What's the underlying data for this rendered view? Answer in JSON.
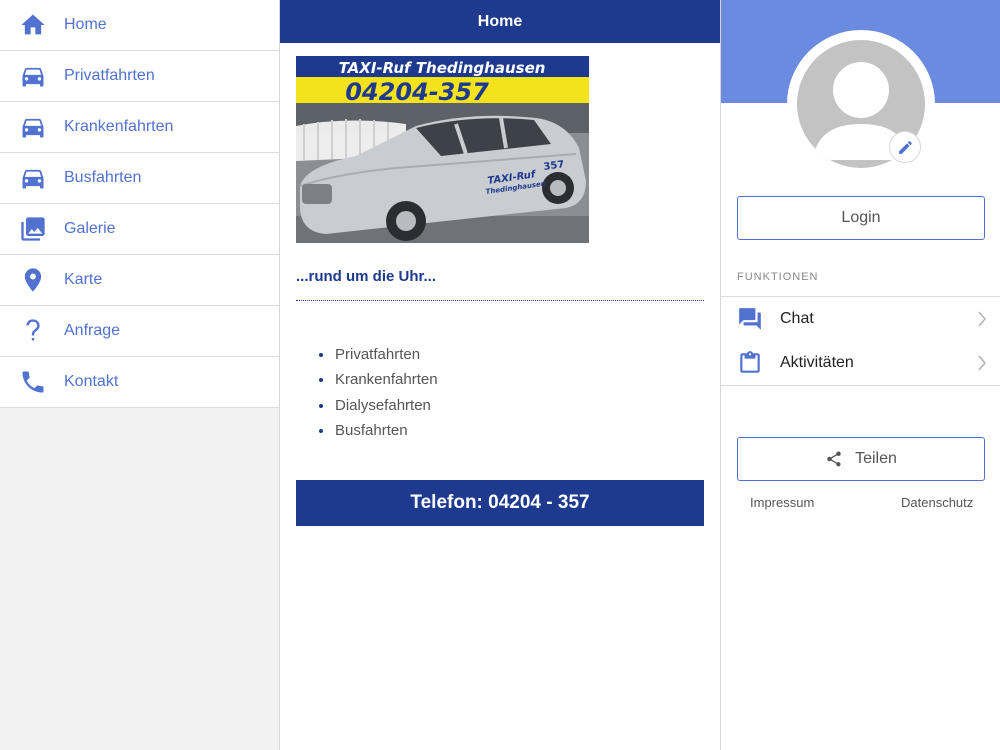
{
  "sidebar": {
    "items": [
      {
        "label": "Home",
        "icon": "home-icon"
      },
      {
        "label": "Privatfahrten",
        "icon": "car-icon"
      },
      {
        "label": "Krankenfahrten",
        "icon": "car-icon"
      },
      {
        "label": "Busfahrten",
        "icon": "car-icon"
      },
      {
        "label": "Galerie",
        "icon": "gallery-icon"
      },
      {
        "label": "Karte",
        "icon": "map-pin-icon"
      },
      {
        "label": "Anfrage",
        "icon": "question-icon"
      },
      {
        "label": "Kontakt",
        "icon": "phone-icon"
      }
    ]
  },
  "main": {
    "title": "Home",
    "hero": {
      "sign_line1": "TAXI-Ruf Thedinghausen",
      "sign_line2": "04204-357",
      "door_text1": "TAXI-Ruf",
      "door_text2": "Thedinghausen",
      "door_number": "357"
    },
    "tagline": "...rund um die Uhr...",
    "services": [
      "Privatfahrten",
      "Krankenfahrten",
      "Dialysefahrten",
      "Busfahrten"
    ],
    "phone_button": "Telefon: 04204 - 357"
  },
  "profile": {
    "login_label": "Login",
    "section_label": "FUNKTIONEN",
    "functions": [
      {
        "label": "Chat",
        "icon": "chat-icon"
      },
      {
        "label": "Aktivitäten",
        "icon": "clipboard-icon"
      }
    ],
    "share_label": "Teilen",
    "impressum": "Impressum",
    "datenschutz": "Datenschutz"
  },
  "colors": {
    "primary_dark": "#1e3a8f",
    "accent": "#5272d0",
    "banner": "#6a8be0",
    "sign_yellow": "#f4e21a"
  }
}
